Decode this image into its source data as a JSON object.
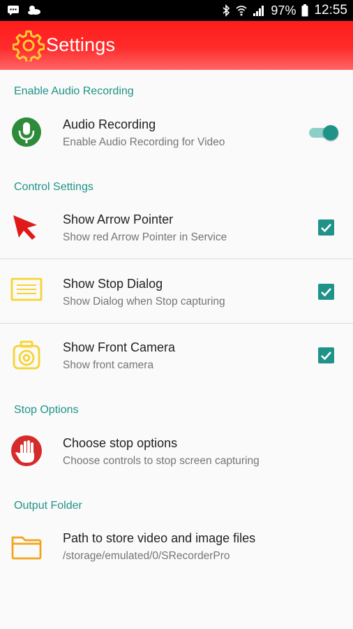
{
  "status_bar": {
    "battery": "97%",
    "time": "12:55",
    "icons": [
      "message-icon",
      "weather-icon",
      "bluetooth-icon",
      "wifi-icon",
      "signal-icon",
      "battery-icon"
    ]
  },
  "app_bar": {
    "title": "Settings",
    "icon": "gear-icon",
    "gradient": [
      "#ff1d1d",
      "#ff6666"
    ]
  },
  "colors": {
    "accent": "#1f9388",
    "accent_light": "#8ccfc8",
    "text_primary": "#212121",
    "text_secondary": "#757575"
  },
  "sections": {
    "audio": {
      "header": "Enable Audio Recording",
      "item": {
        "title": "Audio Recording",
        "subtitle": "Enable Audio Recording for Video",
        "icon": "microphone-icon",
        "toggle_on": true
      }
    },
    "control": {
      "header": "Control Settings",
      "items": [
        {
          "title": "Show Arrow Pointer",
          "subtitle": "Show red Arrow Pointer in Service",
          "icon": "arrow-pointer-icon",
          "checked": true
        },
        {
          "title": "Show Stop Dialog",
          "subtitle": "Show Dialog when Stop capturing",
          "icon": "dialog-icon",
          "checked": true
        },
        {
          "title": "Show Front Camera",
          "subtitle": "Show front camera",
          "icon": "camera-icon",
          "checked": true
        }
      ]
    },
    "stop": {
      "header": "Stop Options",
      "item": {
        "title": "Choose stop options",
        "subtitle": "Choose controls to stop screen capturing",
        "icon": "stop-hand-icon"
      }
    },
    "output": {
      "header": "Output Folder",
      "item": {
        "title": "Path to store video and image files",
        "subtitle": "/storage/emulated/0/SRecorderPro",
        "icon": "folder-icon"
      }
    }
  }
}
